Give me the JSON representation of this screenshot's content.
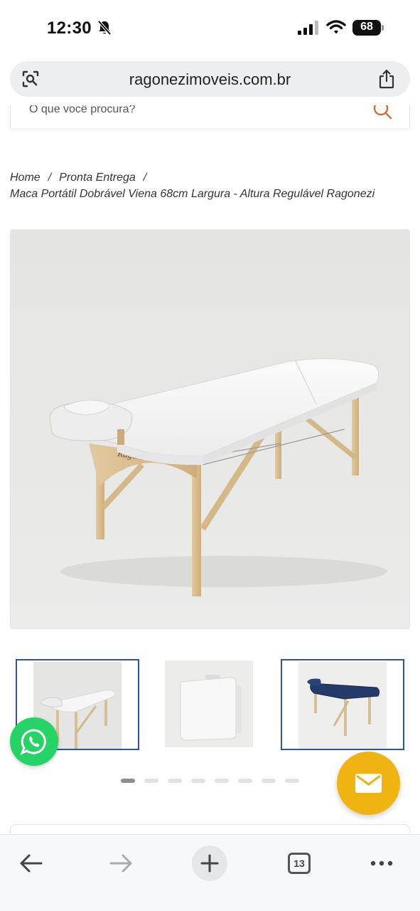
{
  "status_bar": {
    "time": "12:30",
    "battery": "68"
  },
  "browser": {
    "url": "ragonezimoveis.com.br",
    "open_tabs": "13"
  },
  "search": {
    "placeholder": "O que você procura?"
  },
  "breadcrumb": {
    "items": [
      "Home",
      "Pronta Entrega"
    ],
    "separator": "/",
    "current": "Maca Portátil Dobrável Viena 68cm Largura - Altura Regulável Ragonezi"
  },
  "product": {
    "brand_mark": "Ragonezi",
    "image_count": 8,
    "active_image_index": 0
  },
  "colors": {
    "whatsapp": "#25d366",
    "mail_fab": "#f0b412",
    "thumb_selected_border": "#2f55a0",
    "search_icon": "#c8743a"
  },
  "icons": {
    "whatsapp": "whatsapp-icon",
    "mail": "mail-icon",
    "share": "share-icon",
    "lens": "lens-icon",
    "search": "search-icon"
  }
}
